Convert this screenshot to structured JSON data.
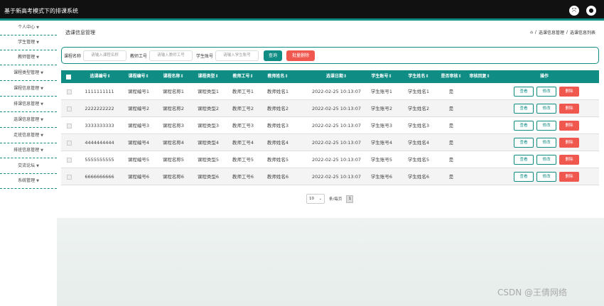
{
  "app": {
    "title": "基于新高考模式下的排课系统"
  },
  "topbar_icons": [
    "fullscreen-icon",
    "user-icon"
  ],
  "sidebar": {
    "items": [
      {
        "label": "个人中心"
      },
      {
        "label": "学生管理"
      },
      {
        "label": "教师管理"
      },
      {
        "label": "课程类型管理"
      },
      {
        "label": "课程信息管理"
      },
      {
        "label": "排课信息管理"
      },
      {
        "label": "选课信息管理"
      },
      {
        "label": "走班信息管理"
      },
      {
        "label": "排班信息管理"
      },
      {
        "label": "交流论坛"
      },
      {
        "label": "系统管理"
      }
    ]
  },
  "page": {
    "title": "选课信息管理"
  },
  "breadcrumb": {
    "items": [
      "选课信息管理",
      "选课信息列表"
    ],
    "separator": "/"
  },
  "search": {
    "fields": [
      {
        "label": "课程名称",
        "placeholder": "请输入课程名称"
      },
      {
        "label": "教师工号",
        "placeholder": "请输入教师工号"
      },
      {
        "label": "学生账号",
        "placeholder": "请输入学生账号"
      }
    ],
    "query_label": "查询",
    "batch_delete_label": "批量删除"
  },
  "table": {
    "columns": [
      "选课编号",
      "课程编号",
      "课程名称",
      "课程类型",
      "教师工号",
      "教师姓名",
      "选课日期",
      "学生账号",
      "学生姓名",
      "是否审核",
      "审核回复",
      "操作"
    ],
    "rows": [
      {
        "select_no": "1111111111",
        "course_no": "课程编号1",
        "course_name": "课程名称1",
        "course_type": "课程类型1",
        "teacher_no": "教师工号1",
        "teacher_name": "教师姓名1",
        "date": "2022-02-25 10:13:07",
        "student_account": "学生账号1",
        "student_name": "学生姓名1",
        "reviewed": "是",
        "reply": ""
      },
      {
        "select_no": "2222222222",
        "course_no": "课程编号2",
        "course_name": "课程名称2",
        "course_type": "课程类型2",
        "teacher_no": "教师工号2",
        "teacher_name": "教师姓名2",
        "date": "2022-02-25 10:13:07",
        "student_account": "学生账号2",
        "student_name": "学生姓名2",
        "reviewed": "是",
        "reply": ""
      },
      {
        "select_no": "3333333333",
        "course_no": "课程编号3",
        "course_name": "课程名称3",
        "course_type": "课程类型3",
        "teacher_no": "教师工号3",
        "teacher_name": "教师姓名3",
        "date": "2022-02-25 10:13:07",
        "student_account": "学生账号3",
        "student_name": "学生姓名3",
        "reviewed": "是",
        "reply": ""
      },
      {
        "select_no": "4444444444",
        "course_no": "课程编号4",
        "course_name": "课程名称4",
        "course_type": "课程类型4",
        "teacher_no": "教师工号4",
        "teacher_name": "教师姓名4",
        "date": "2022-02-25 10:13:07",
        "student_account": "学生账号4",
        "student_name": "学生姓名4",
        "reviewed": "是",
        "reply": ""
      },
      {
        "select_no": "5555555555",
        "course_no": "课程编号5",
        "course_name": "课程名称5",
        "course_type": "课程类型5",
        "teacher_no": "教师工号5",
        "teacher_name": "教师姓名5",
        "date": "2022-02-25 10:13:07",
        "student_account": "学生账号5",
        "student_name": "学生姓名5",
        "reviewed": "是",
        "reply": ""
      },
      {
        "select_no": "6666666666",
        "course_no": "课程编号6",
        "course_name": "课程名称6",
        "course_type": "课程类型6",
        "teacher_no": "教师工号6",
        "teacher_name": "教师姓名6",
        "date": "2022-02-25 10:13:07",
        "student_account": "学生账号6",
        "student_name": "学生姓名6",
        "reviewed": "是",
        "reply": ""
      }
    ],
    "actions": {
      "view": "查看",
      "edit": "修改",
      "delete": "删除"
    }
  },
  "pagination": {
    "page_size": "10",
    "per_page_text": "条/每页",
    "current_page": "1"
  },
  "watermark": "CSDN @王倩网络",
  "colors": {
    "accent": "#0f8c84",
    "danger": "#f0574f",
    "topbar": "#111111"
  }
}
